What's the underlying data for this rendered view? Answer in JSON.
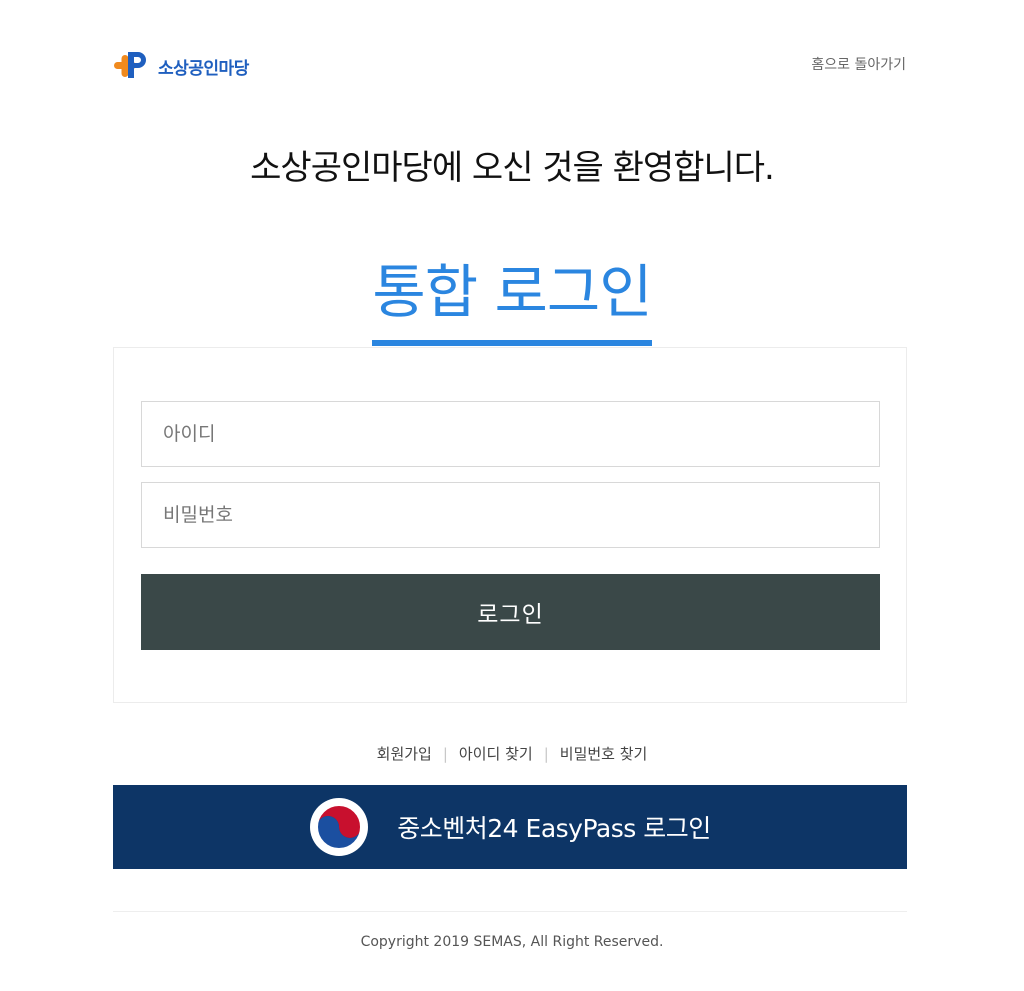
{
  "header": {
    "logo_text": "소상공인마당",
    "home_link": "홈으로 돌아가기"
  },
  "welcome": "소상공인마당에 오신 것을 환영합니다.",
  "login_title": "통합 로그인",
  "form": {
    "id_placeholder": "아이디",
    "id_value": "",
    "pw_placeholder": "비밀번호",
    "pw_value": "",
    "login_button": "로그인"
  },
  "links": {
    "signup": "회원가입",
    "find_id": "아이디 찾기",
    "find_pw": "비밀번호 찾기"
  },
  "easypass": {
    "label": "중소벤처24 EasyPass 로그인"
  },
  "footer": {
    "copyright": "Copyright 2019 SEMAS, All Right Reserved."
  },
  "colors": {
    "brand_blue": "#2b86e0",
    "logo_orange": "#f08a1e",
    "button_dark": "#3a4848",
    "easypass_navy": "#0d3566"
  },
  "icons": {
    "logo": "cross-p-logo-icon",
    "easypass": "taegeuk-emblem-icon"
  }
}
